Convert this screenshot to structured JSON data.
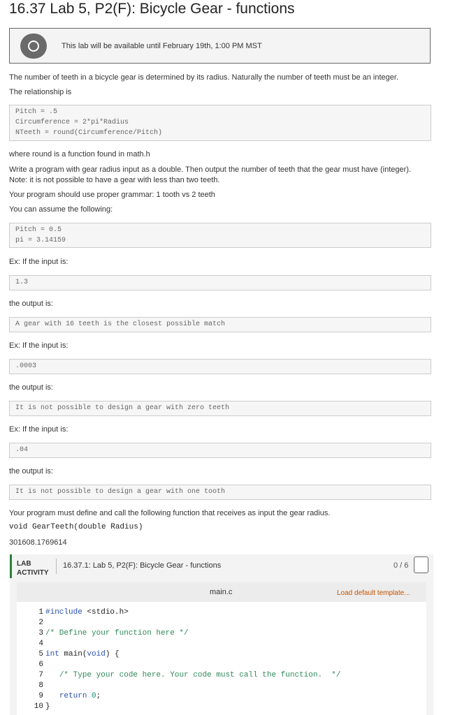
{
  "page_title": "16.37 Lab 5, P2(F): Bicycle Gear - functions",
  "banner": {
    "text": "This lab will be available until February 19th, 1:00 PM MST",
    "icon": "eye-icon"
  },
  "intro": [
    "The number of teeth in a bicycle gear is determined by its radius. Naturally the number of teeth must be an integer.",
    "The relationship is"
  ],
  "formula_lines": [
    "Pitch = .5",
    "Circumference = 2*pi*Radius",
    "NTeeth = round(Circumference/Pitch)"
  ],
  "after_formula": [
    "where round is a function found in math.h",
    "Write a program with gear radius input as a double. Then output the number of teeth that the gear must have (integer).",
    "Note: it is not possible to have a gear with less than two teeth.",
    "Your program should use proper grammar: 1 tooth vs 2 teeth",
    "You can assume the following:"
  ],
  "assumptions": [
    "Pitch = 0.5",
    "pi = 3.14159"
  ],
  "examples": [
    {
      "intro": "Ex: If the input is:",
      "input": "1.3",
      "output_label": "the output is:",
      "output": "A gear with 16 teeth is the closest possible match"
    },
    {
      "intro": "Ex: If the input is:",
      "input": ".0003",
      "output_label": "the output is:",
      "output": "It is not possible to design a gear with zero teeth"
    },
    {
      "intro": "Ex: If the input is:",
      "input": ".04",
      "output_label": "the output is:",
      "output": "It is not possible to design a gear with one tooth"
    }
  ],
  "function_intro": "Your program must define and call the following function that receives as input the gear radius.",
  "function_signature": "void GearTeeth(double Radius)",
  "activity_id": "301608.1769614",
  "lab": {
    "label_line1": "LAB",
    "label_line2": "ACTIVITY",
    "title": "16.37.1: Lab 5, P2(F): Bicycle Gear - functions",
    "score": "0 / 6",
    "accent_color": "#2a7f3a"
  },
  "editor": {
    "filename": "main.c",
    "load_template": "Load default template...",
    "line_numbers": [
      "1",
      "2",
      "3",
      "4",
      "5",
      "6",
      "7",
      "8",
      "9",
      "10"
    ]
  }
}
